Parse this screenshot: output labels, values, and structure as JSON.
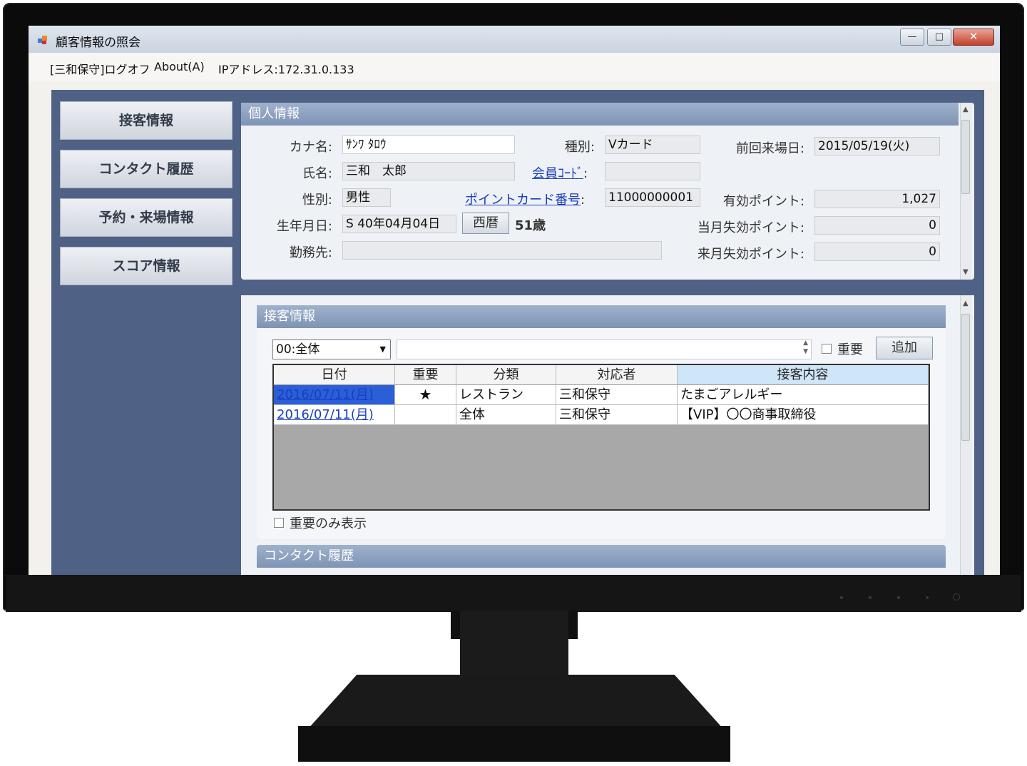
{
  "window": {
    "title": "顧客情報の照会",
    "min_label": "—",
    "max_label": "□",
    "close_label": "✕"
  },
  "menu": {
    "logoff": "[三和保守]ログオフ",
    "about": "About(A)",
    "ip": "IPアドレス:172.31.0.133"
  },
  "nav": [
    {
      "label": "接客情報"
    },
    {
      "label": "コンタクト履歴"
    },
    {
      "label": "予約・来場情報"
    },
    {
      "label": "スコア情報"
    }
  ],
  "personal": {
    "header": "個人情報",
    "kana_label": "カナ名:",
    "kana_value": "ｻﾝﾜ ﾀﾛｳ",
    "name_label": "氏名:",
    "name_value": "三和　太郎",
    "gender_label": "性別:",
    "gender_value": "男性",
    "birth_label": "生年月日:",
    "birth_value": "S  40年04月04日",
    "seireki_button": "西暦",
    "age": "51歳",
    "work_label": "勤務先:",
    "work_value": "",
    "type_label": "種別:",
    "type_value": "Vカード",
    "member_code_link": "会員ｺｰﾄﾞ",
    "member_code_colon": ":",
    "member_code_value": "",
    "pointcard_link": "ポイントカード番号",
    "pointcard_colon": ":",
    "pointcard_value": "11000000001",
    "last_visit_label": "前回来場日:",
    "last_visit_value": "2015/05/19(火)",
    "valid_points_label": "有効ポイント:",
    "valid_points_value": "1,027",
    "this_month_expire_label": "当月失効ポイント:",
    "this_month_expire_value": "0",
    "next_month_expire_label": "来月失効ポイント:",
    "next_month_expire_value": "0"
  },
  "reception": {
    "header": "接客情報",
    "category_select": "00:全体",
    "important_label": "重要",
    "add_button": "追加",
    "only_important_label": "重要のみ表示",
    "columns": [
      "日付",
      "重要",
      "分類",
      "対応者",
      "接客内容"
    ],
    "rows": [
      {
        "date": "2016/07/11(月)",
        "important": "★",
        "category": "レストラン",
        "staff": "三和保守",
        "content": "たまごアレルギー"
      },
      {
        "date": "2016/07/11(月)",
        "important": "",
        "category": "全体",
        "staff": "三和保守",
        "content": "【VIP】〇〇商事取締役"
      }
    ]
  },
  "contact_history": {
    "header": "コンタクト履歴"
  }
}
